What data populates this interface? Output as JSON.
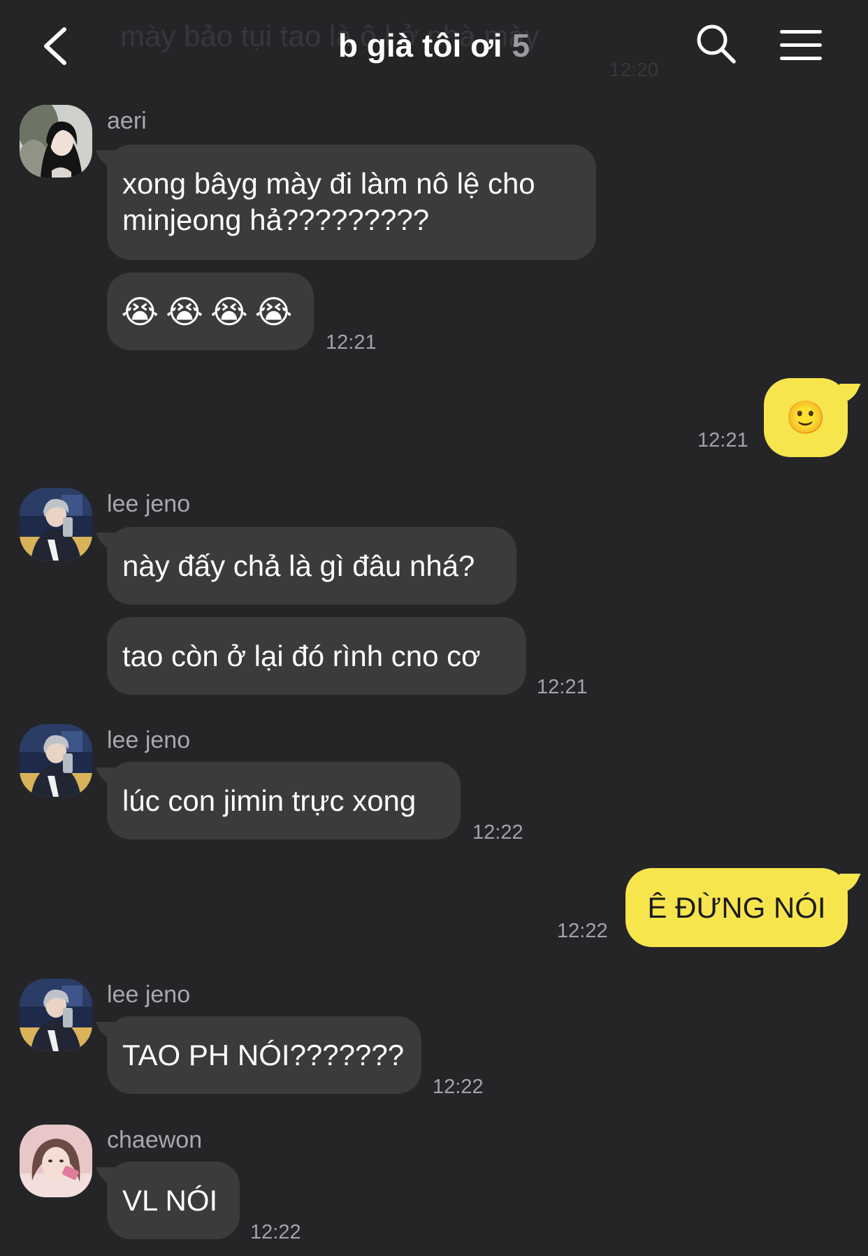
{
  "header": {
    "ghost_text": "mày bảo tụi tao là ô l ở nhà mày",
    "ghost_time": "12:20",
    "title": "b già tôi ơi",
    "member_count": "5",
    "icons": {
      "back": "back-arrow-icon",
      "search": "search-icon",
      "menu": "hamburger-menu-icon"
    }
  },
  "messages": {
    "m1": {
      "sender": "aeri",
      "text": "xong bâyg mày đi làm nô lệ cho minjeong hả?????????"
    },
    "m2": {
      "text": "😭😭😭😭",
      "time": "12:21"
    },
    "m3": {
      "text": "🙂",
      "time": "12:21"
    },
    "m4": {
      "sender": "lee jeno",
      "text": "này đấy chả là gì đâu nhá?"
    },
    "m5": {
      "text": "tao còn ở lại đó rình cno cơ",
      "time": "12:21"
    },
    "m6": {
      "sender": "lee jeno",
      "text": "lúc con jimin trực xong",
      "time": "12:22"
    },
    "m7": {
      "text": "Ê ĐỪNG NÓI",
      "time": "12:22"
    },
    "m8": {
      "sender": "lee jeno",
      "text": "TAO PH NÓI???????",
      "time": "12:22"
    },
    "m9": {
      "sender": "chaewon",
      "text": "VL NÓI",
      "time": "12:22"
    }
  },
  "colors": {
    "background": "#252528",
    "incoming_bubble": "#3b3b3e",
    "outgoing_bubble": "#f7e54e",
    "timestamp": "#a3a3a8"
  }
}
